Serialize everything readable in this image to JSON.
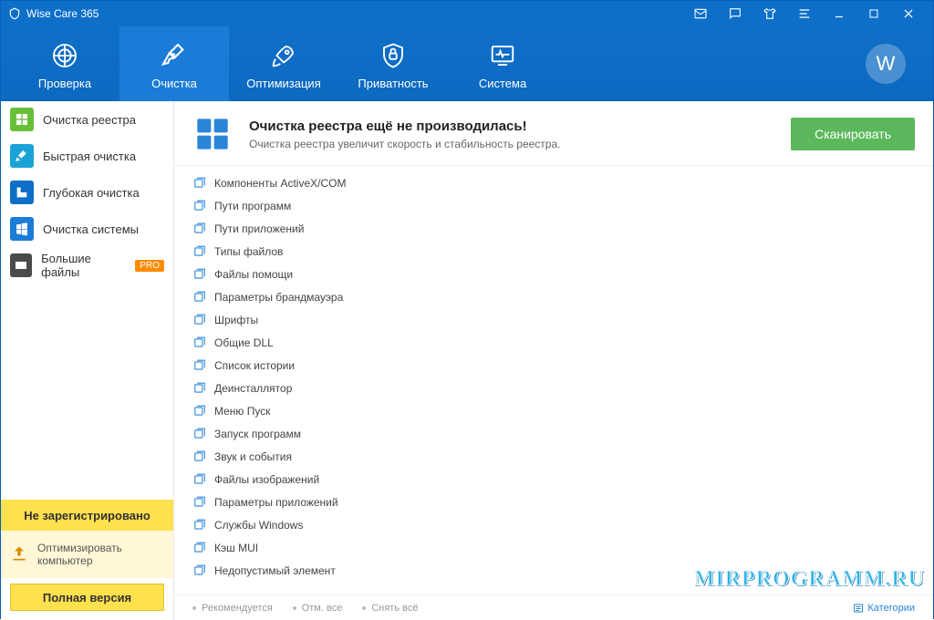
{
  "titlebar": {
    "app_name": "Wise Care 365"
  },
  "nav": {
    "items": [
      {
        "label": "Проверка"
      },
      {
        "label": "Очистка"
      },
      {
        "label": "Оптимизация"
      },
      {
        "label": "Приватность"
      },
      {
        "label": "Система"
      }
    ],
    "user_initial": "W"
  },
  "sidebar": {
    "items": [
      {
        "label": "Очистка реестра",
        "color": "#6abf3a"
      },
      {
        "label": "Быстрая очистка",
        "color": "#1aa3d6"
      },
      {
        "label": "Глубокая очистка",
        "color": "#0e6fc8"
      },
      {
        "label": "Очистка системы",
        "color": "#1a7cd6"
      },
      {
        "label": "Большие файлы",
        "color": "#4a4a4a",
        "pro": "PRO"
      }
    ],
    "unregistered": "Не зарегистрировано",
    "promo": "Оптимизировать компьютер",
    "full_version": "Полная версия"
  },
  "header": {
    "title": "Очистка реестра ещё не производилась!",
    "subtitle": "Очистка реестра увеличит скорость и стабильность реестра.",
    "scan_label": "Сканировать"
  },
  "items": [
    {
      "label": "Компоненты ActiveX/COM"
    },
    {
      "label": "Пути программ"
    },
    {
      "label": "Пути приложений"
    },
    {
      "label": "Типы файлов"
    },
    {
      "label": "Файлы помощи"
    },
    {
      "label": "Параметры брандмауэра"
    },
    {
      "label": "Шрифты"
    },
    {
      "label": "Общие DLL"
    },
    {
      "label": "Список истории"
    },
    {
      "label": "Деинсталлятор"
    },
    {
      "label": "Меню Пуск"
    },
    {
      "label": "Запуск программ"
    },
    {
      "label": "Звук и события"
    },
    {
      "label": "Файлы изображений"
    },
    {
      "label": "Параметры приложений"
    },
    {
      "label": "Службы Windows"
    },
    {
      "label": "Кэш MUI"
    },
    {
      "label": "Недопустимый элемент"
    }
  ],
  "footer": {
    "recommend": "Рекомендуется",
    "select_all": "Отм. все",
    "deselect_all": "Снять всё",
    "categories": "Категории"
  },
  "watermark": "MIRPROGRAMM.RU"
}
